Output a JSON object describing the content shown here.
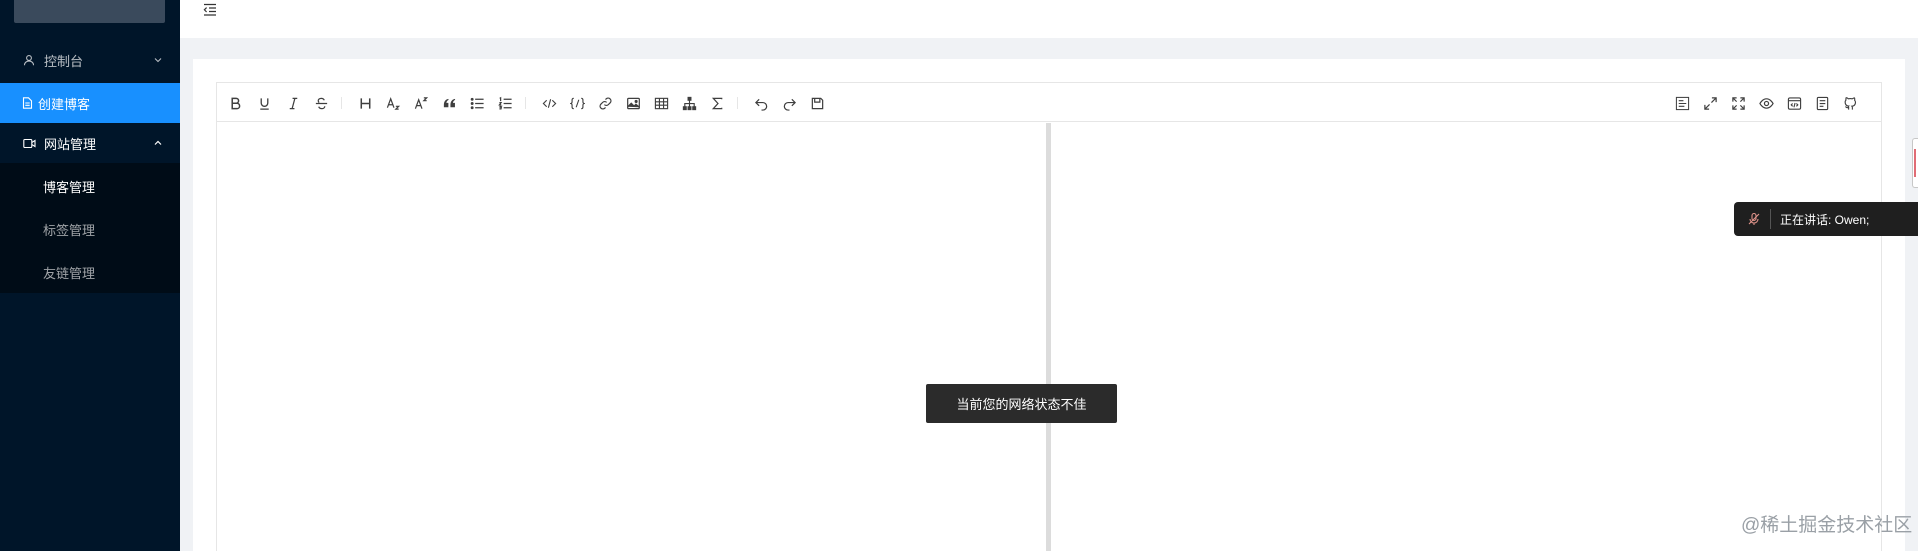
{
  "sidebar": {
    "items": [
      {
        "label": "控制台",
        "icon": "user-icon"
      },
      {
        "label": "创建博客",
        "icon": "file-icon"
      },
      {
        "label": "网站管理",
        "icon": "video-icon"
      }
    ],
    "submenu": [
      {
        "label": "博客管理"
      },
      {
        "label": "标签管理"
      },
      {
        "label": "友链管理"
      }
    ]
  },
  "header": {
    "fold_icon": "menu-fold-icon"
  },
  "toolbar": {
    "left": [
      "bold-icon",
      "underline-icon",
      "italic-icon",
      "strikethrough-icon",
      "title-icon",
      "subscript-icon",
      "superscript-icon",
      "quote-icon",
      "unordered-list-icon",
      "ordered-list-icon",
      "code-row-icon",
      "code-block-icon",
      "link-icon",
      "image-icon",
      "table-icon",
      "mermaid-icon",
      "katex-icon",
      "revoke-icon",
      "next-icon",
      "save-icon"
    ],
    "right": [
      "prettier-icon",
      "page-fullscreen-icon",
      "fullscreen-icon",
      "preview-icon",
      "html-preview-icon",
      "catalog-icon",
      "github-icon"
    ]
  },
  "toast": {
    "text": "当前您的网络状态不佳"
  },
  "speaking": {
    "text": "正在讲话: Owen;"
  },
  "watermark": {
    "text": "@稀土掘金技术社区"
  },
  "colors": {
    "sidebar": "#001529",
    "submenu": "#000c17",
    "active": "#1890ff",
    "toast": "#2b2b2b"
  }
}
